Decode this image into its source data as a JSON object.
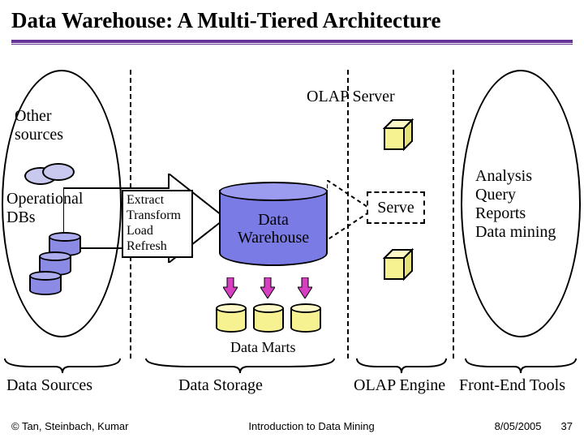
{
  "title": "Data Warehouse: A Multi-Tiered Architecture",
  "left_ellipse": {
    "other_sources": "Other\nsources",
    "operational_dbs": "Operational\nDBs"
  },
  "etl": {
    "l1": "Extract",
    "l2": "Transform",
    "l3": "Load",
    "l4": "Refresh"
  },
  "dw_label_l1": "Data",
  "dw_label_l2": "Warehouse",
  "olap_server_label": "OLAP Server",
  "serve_label": "Serve",
  "data_marts_label": "Data Marts",
  "right_ellipse": {
    "l1": "Analysis",
    "l2": "Query",
    "l3": "Reports",
    "l4": "Data mining"
  },
  "tiers": {
    "t1": "Data Sources",
    "t2": "Data Storage",
    "t3": "OLAP Engine",
    "t4": "Front-End Tools"
  },
  "footer": {
    "left": "© Tan, Steinbach, Kumar",
    "center": "Introduction to Data Mining",
    "date": "8/05/2005",
    "page": "37"
  }
}
